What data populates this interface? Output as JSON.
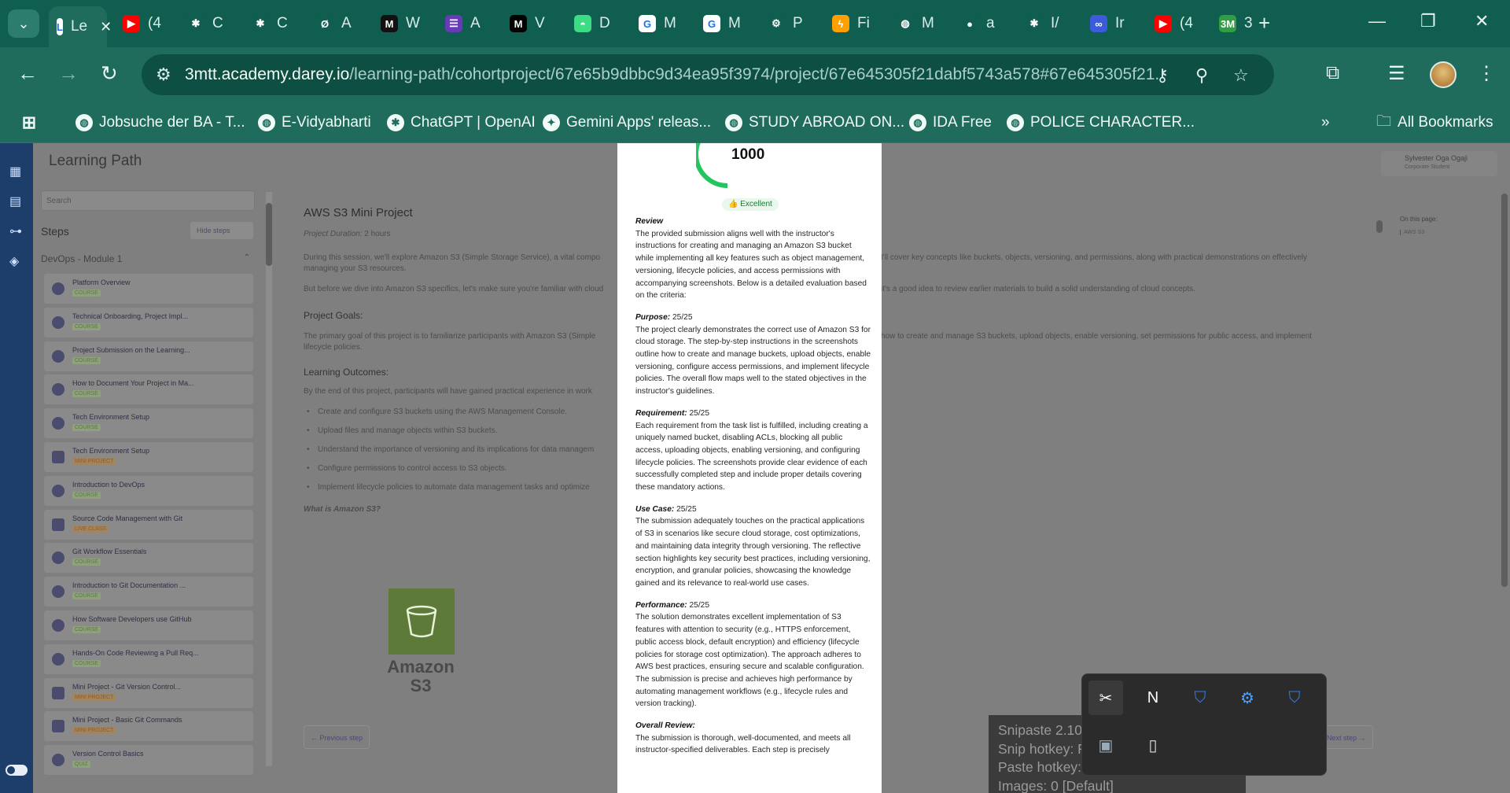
{
  "browser": {
    "tabs": [
      {
        "label": "Le",
        "icon": "learning-icon",
        "color": "#ffffff",
        "glyph": "L",
        "active": true
      },
      {
        "label": "(4",
        "icon": "youtube-icon",
        "color": "#ff0000",
        "glyph": "▶"
      },
      {
        "label": "C",
        "icon": "chatgpt-icon",
        "color": "#0f5e50",
        "glyph": "✱"
      },
      {
        "label": "C",
        "icon": "chatgpt-icon",
        "color": "#0f5e50",
        "glyph": "✱"
      },
      {
        "label": "A",
        "icon": "perplexity-icon",
        "color": "#0f5e50",
        "glyph": "Ø"
      },
      {
        "label": "W",
        "icon": "w-logo-icon",
        "color": "#111111",
        "glyph": "M"
      },
      {
        "label": "A",
        "icon": "forms-icon",
        "color": "#673ab7",
        "glyph": "☰"
      },
      {
        "label": "V",
        "icon": "m-logo-icon",
        "color": "#000000",
        "glyph": "M"
      },
      {
        "label": "D",
        "icon": "android-icon",
        "color": "#3ddc84",
        "glyph": "◓"
      },
      {
        "label": "M",
        "icon": "google-icon",
        "color": "#ffffff",
        "glyph": "G"
      },
      {
        "label": "M",
        "icon": "google-icon",
        "color": "#ffffff",
        "glyph": "G"
      },
      {
        "label": "P",
        "icon": "gear-icon",
        "color": "#0f5e50",
        "glyph": "⚙"
      },
      {
        "label": "Fi",
        "icon": "firebase-icon",
        "color": "#ffa000",
        "glyph": "ϟ"
      },
      {
        "label": "M",
        "icon": "globe-icon",
        "color": "#0f5e50",
        "glyph": "◍"
      },
      {
        "label": "a",
        "icon": "github-icon",
        "color": "#0f5e50",
        "glyph": "●"
      },
      {
        "label": "I/",
        "icon": "chatgpt-icon",
        "color": "#0f5e50",
        "glyph": "✱"
      },
      {
        "label": "Ir",
        "icon": "vs-icon",
        "color": "#3b5bdb",
        "glyph": "∞"
      },
      {
        "label": "(4",
        "icon": "youtube-icon",
        "color": "#ff0000",
        "glyph": "▶"
      },
      {
        "label": "3",
        "icon": "3m-icon",
        "color": "#2f9e44",
        "glyph": "3M"
      }
    ],
    "url_host": "3mtt.academy.darey.io",
    "url_path": "/learning-path/cohortproject/67e65b9dbbc9d34ea95f3974/project/67e645305f21dabf5743a578#67e645305f21...",
    "bookmarks": [
      {
        "label": "Jobsuche der BA - T...",
        "glyph": "◍"
      },
      {
        "label": "E-Vidyabharti",
        "glyph": "◍"
      },
      {
        "label": "ChatGPT | OpenAI",
        "glyph": "✱"
      },
      {
        "label": "Gemini Apps' releas...",
        "glyph": "✦"
      },
      {
        "label": "STUDY ABROAD ON...",
        "glyph": "◍"
      },
      {
        "label": "IDA Free",
        "glyph": "◍"
      },
      {
        "label": "POLICE CHARACTER...",
        "glyph": "◍"
      }
    ],
    "all_bookmarks": "All Bookmarks",
    "more_glyph": "»"
  },
  "page": {
    "title": "Learning Path",
    "search_placeholder": "Search",
    "steps_heading": "Steps",
    "hide_steps": "Hide steps",
    "module": "DevOps - Module 1",
    "steps": [
      {
        "title": "Platform Overview",
        "badge": "COURSE",
        "kind": "course"
      },
      {
        "title": "Technical Onboarding, Project Impl...",
        "badge": "COURSE",
        "kind": "course"
      },
      {
        "title": "Project Submission on the Learning...",
        "badge": "COURSE",
        "kind": "course"
      },
      {
        "title": "How to Document Your Project in Ma...",
        "badge": "COURSE",
        "kind": "course"
      },
      {
        "title": "Tech Environment Setup",
        "badge": "COURSE",
        "kind": "course"
      },
      {
        "title": "Tech Environment Setup",
        "badge": "MINI PROJECT",
        "kind": "project"
      },
      {
        "title": "Introduction to DevOps",
        "badge": "COURSE",
        "kind": "course"
      },
      {
        "title": "Source Code Management with Git",
        "badge": "LIVE CLASS",
        "kind": "project"
      },
      {
        "title": "Git Workflow Essentials",
        "badge": "COURSE",
        "kind": "course"
      },
      {
        "title": "Introduction to Git Documentation ...",
        "badge": "COURSE",
        "kind": "course"
      },
      {
        "title": "How Software Developers use GitHub",
        "badge": "COURSE",
        "kind": "course"
      },
      {
        "title": "Hands-On Code Reviewing a Pull Req...",
        "badge": "COURSE",
        "kind": "course"
      },
      {
        "title": "Mini Project - Git Version Control...",
        "badge": "MINI PROJECT",
        "kind": "project"
      },
      {
        "title": "Mini Project - Basic Git Commands",
        "badge": "MINI PROJECT",
        "kind": "project"
      },
      {
        "title": "Version Control Basics",
        "badge": "QUIZ",
        "kind": "course"
      }
    ],
    "content": {
      "title": "AWS S3 Mini Project",
      "duration_label": "Project Duration:",
      "duration_value": "2 hours",
      "intro_left": "During this session, we'll explore Amazon S3 (Simple Storage Service), a vital compo",
      "intro_right": "I'll cover key concepts like buckets, objects, versioning, and permissions, along with practical demonstrations on effectively",
      "intro_line2": "managing your S3 resources.",
      "before_left": "But before we dive into Amazon S3 specifics, let's make sure you're familiar with cloud",
      "before_right": "it's a good idea to review earlier materials to build a solid understanding of cloud concepts.",
      "goals_heading": "Project Goals:",
      "goals_left": "The primary goal of this project is to familiarize participants with Amazon S3 (Simple",
      "goals_right": "how to create and manage S3 buckets, upload objects, enable versioning, set permissions for public access, and implement",
      "goals_line2": "lifecycle policies.",
      "outcomes_heading": "Learning Outcomes:",
      "outcomes_intro": "By the end of this project, participants will have gained practical experience in work",
      "outcomes": [
        "Create and configure S3 buckets using the AWS Management Console.",
        "Upload files and manage objects within S3 buckets.",
        "Understand the importance of versioning and its implications for data managem",
        "Configure permissions to control access to S3 objects.",
        "Implement lifecycle policies to automate data management tasks and optimize"
      ],
      "what_is": "What is Amazon S3?",
      "logo_line1": "Amazon",
      "logo_line2": "S3",
      "prev": "← Previous step",
      "next": "Next step →"
    },
    "user_name": "Sylvester Oga Ogaji",
    "user_role": "Corporate Student",
    "on_this_page": "On this page:",
    "on_this_page_item": "AWS S3"
  },
  "modal": {
    "score": "1000",
    "badge": "Excellent",
    "badge_emoji": "👍",
    "review_heading": "Review",
    "review_text": "The provided submission aligns well with the instructor's instructions for creating and managing an Amazon S3 bucket while implementing all key features such as object management, versioning, lifecycle policies, and access permissions with accompanying screenshots. Below is a detailed evaluation based on the criteria:",
    "sections": [
      {
        "heading": "Purpose:",
        "score": " 25/25",
        "text": "The project clearly demonstrates the correct use of Amazon S3 for cloud storage. The step-by-step instructions in the screenshots outline how to create and manage buckets, upload objects, enable versioning, configure access permissions, and implement lifecycle policies. The overall flow maps well to the stated objectives in the instructor's guidelines."
      },
      {
        "heading": "Requirement:",
        "score": " 25/25",
        "text": "Each requirement from the task list is fulfilled, including creating a uniquely named bucket, disabling ACLs, blocking all public access, uploading objects, enabling versioning, and configuring lifecycle policies. The screenshots provide clear evidence of each successfully completed step and include proper details covering these mandatory actions."
      },
      {
        "heading": "Use Case:",
        "score": " 25/25",
        "text": "The submission adequately touches on the practical applications of S3 in scenarios like secure cloud storage, cost optimizations, and maintaining data integrity through versioning. The reflective section highlights key security best practices, including versioning, encryption, and granular policies, showcasing the knowledge gained and its relevance to real-world use cases."
      },
      {
        "heading": "Performance:",
        "score": " 25/25",
        "text": "The solution demonstrates excellent implementation of S3 features with attention to security (e.g., HTTPS enforcement, public access block, default encryption) and efficiency (lifecycle policies for storage cost optimization). The approach adheres to AWS best practices, ensuring secure and scalable configuration. The submission is precise and achieves high performance by automating management workflows (e.g., lifecycle rules and version tracking)."
      },
      {
        "heading": "Overall Review:",
        "score": "",
        "text": "The submission is thorough, well-documented, and meets all instructor-specified deliverables. Each step is precisely"
      }
    ]
  },
  "snipaste": {
    "lines": [
      "Snipaste 2.10.8 Free (Microsoft Store)",
      "Snip hotkey: F1",
      "Paste hotkey: F3",
      "Images: 0 [Default]"
    ]
  },
  "tray": {
    "icons": [
      {
        "name": "snipaste-tray-icon",
        "glyph": "✂",
        "color": "#ffffff"
      },
      {
        "name": "notion-tray-icon",
        "glyph": "N",
        "color": "#ffffff"
      },
      {
        "name": "defender-tray-icon",
        "glyph": "⛉",
        "color": "#2f7de1"
      },
      {
        "name": "tool-tray-icon",
        "glyph": "⚙",
        "color": "#4aa3ff"
      },
      {
        "name": "security-check-tray-icon",
        "glyph": "⛉",
        "color": "#2f7de1"
      },
      {
        "name": "app-tray-icon",
        "glyph": "▣",
        "color": "#9ab"
      },
      {
        "name": "usb-tray-icon",
        "glyph": "▯",
        "color": "#dddddd"
      }
    ]
  }
}
